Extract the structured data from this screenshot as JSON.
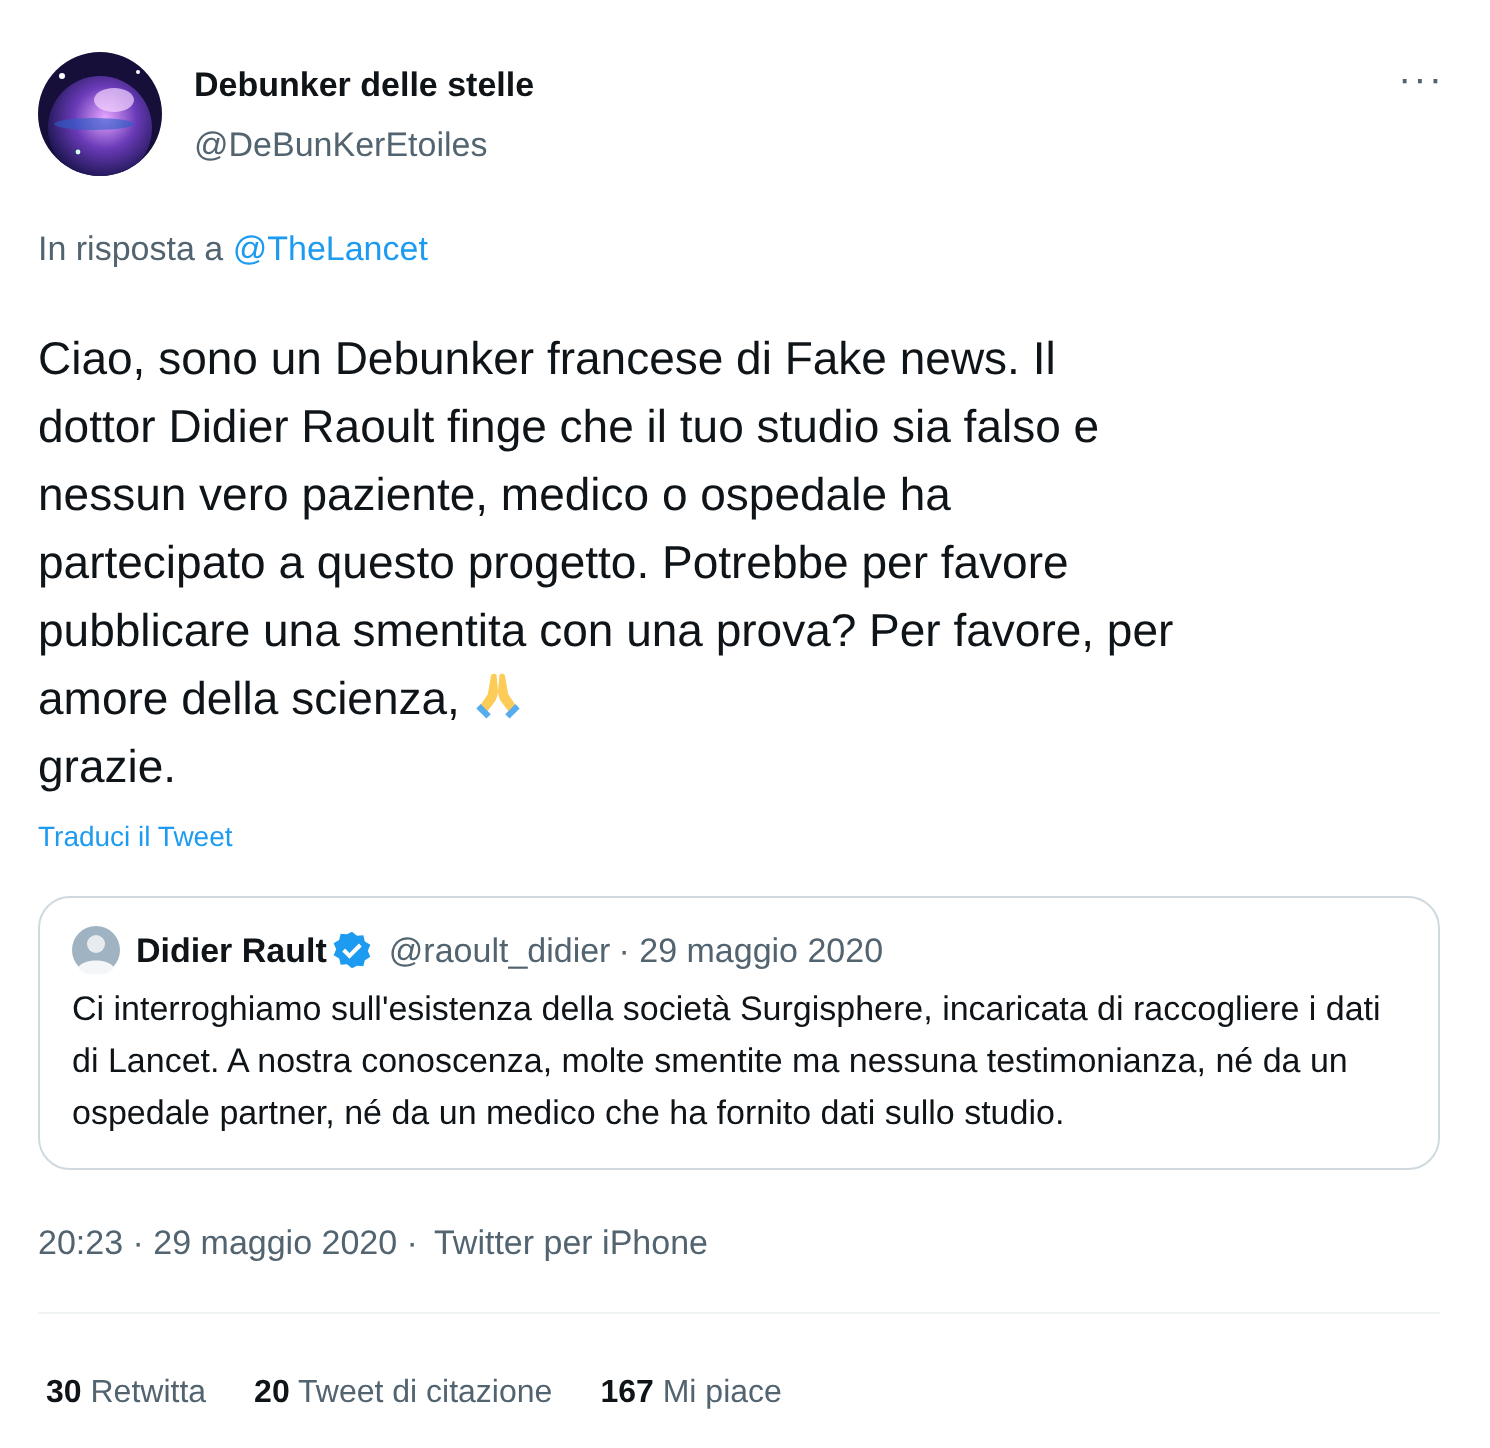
{
  "author": {
    "name": "Debunker delle stelle",
    "handle": "@DeBunKerEtoiles"
  },
  "more_button": "···",
  "reply_to": {
    "prefix": "In risposta a",
    "mention": "@TheLancet"
  },
  "body": {
    "lines": [
      "Ciao, sono un Debunker francese di Fake news. Il",
      "dottor Didier Raoult finge che il tuo studio sia falso e",
      "nessun vero paziente, medico o ospedale ha",
      "partecipato a questo progetto. Potrebbe per favore",
      "pubblicare una smentita con una prova? Per favore, per"
    ],
    "before_emoji": "amore della scienza,",
    "after_emoji": "grazie."
  },
  "translate_link": "Traduci il Tweet",
  "quoted": {
    "name": "Didier Rault",
    "verified": true,
    "handle": "@raoult_didier",
    "date": "· 29 maggio 2020",
    "text": "Ci interroghiamo sull'esistenza della società Surgisphere, incaricata di raccogliere i dati di Lancet. A nostra conoscenza, molte smentite ma nessuna testimonianza, né da un ospedale partner, né da un medico che ha fornito dati sullo studio."
  },
  "meta": {
    "time": "20:23 · 29 maggio 2020 ·",
    "source": "Twitter per iPhone"
  },
  "stats": [
    {
      "count": "30",
      "label": "Retwitta"
    },
    {
      "count": "20",
      "label": "Tweet di citazione"
    },
    {
      "count": "167",
      "label": "Mi piace"
    }
  ]
}
